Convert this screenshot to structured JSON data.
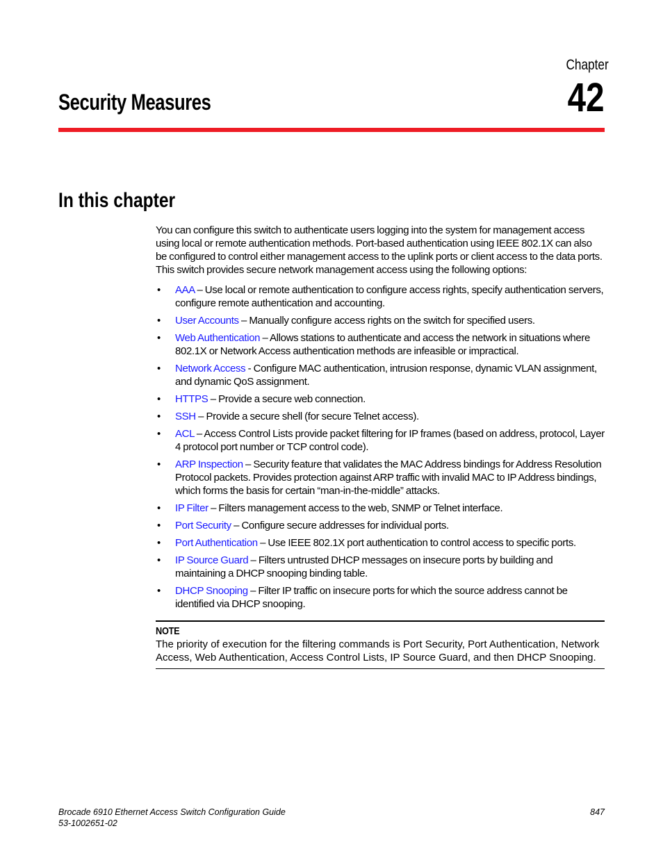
{
  "header": {
    "chapter_label": "Chapter",
    "chapter_number": "42",
    "title": "Security Measures",
    "rule_color": "#ee1c25"
  },
  "section": {
    "title": "In this chapter",
    "intro": "You can configure this switch to authenticate users logging into the system for management access using local or remote authentication methods. Port-based authentication using IEEE 802.1X can also be configured to control either management access to the uplink ports or client access to the data ports. This switch provides secure network management access using the following options:",
    "link_color": "#1a1aff",
    "items": [
      {
        "link": "AAA",
        "sep": " – ",
        "text": "Use local or remote authentication to configure access rights, specify authentication servers, configure remote authentication and accounting."
      },
      {
        "link": "User Accounts",
        "sep": " – ",
        "text": "Manually configure access rights on the switch for specified users."
      },
      {
        "link": "Web Authentication",
        "sep": " – ",
        "text": "Allows stations to authenticate and access the network in situations where 802.1X or Network Access authentication methods are infeasible or impractical."
      },
      {
        "link": "Network Access",
        "sep": " - ",
        "text": "Configure MAC authentication, intrusion response, dynamic VLAN assignment, and dynamic QoS assignment."
      },
      {
        "link": "HTTPS",
        "sep": " – ",
        "text": "Provide a secure web connection."
      },
      {
        "link": "SSH",
        "sep": " – ",
        "text": "Provide a secure shell (for secure Telnet access)."
      },
      {
        "link": "ACL",
        "sep": " – ",
        "text": "Access Control Lists provide packet filtering for IP frames (based on address, protocol, Layer 4 protocol port number or TCP control code)."
      },
      {
        "link": "ARP Inspection",
        "sep": " – ",
        "text": "Security feature that validates the MAC Address bindings for Address Resolution Protocol packets. Provides protection against ARP traffic with invalid MAC to IP Address bindings, which forms the basis for certain “man-in-the-middle” attacks."
      },
      {
        "link": "IP Filter",
        "sep": " – ",
        "text": "Filters management access to the web, SNMP or Telnet interface."
      },
      {
        "link": "Port Security",
        "sep": " – ",
        "text": "Configure secure addresses for individual ports."
      },
      {
        "link": "Port Authentication",
        "sep": " – ",
        "text": "Use IEEE 802.1X port authentication to control access to specific ports."
      },
      {
        "link": "IP Source Guard",
        "sep": " – ",
        "text": "Filters untrusted DHCP messages on insecure ports by building and maintaining a DHCP snooping binding table."
      },
      {
        "link": "DHCP Snooping",
        "sep": " – ",
        "text": "Filter IP traffic on insecure ports for which the source address cannot be identified via DHCP snooping."
      }
    ],
    "note": {
      "label": "NOTE",
      "text": "The priority of execution for the filtering commands is Port Security, Port Authentication, Network Access, Web Authentication, Access Control Lists, IP Source Guard, and then DHCP Snooping."
    }
  },
  "footer": {
    "guide_title": "Brocade 6910 Ethernet Access Switch Configuration Guide",
    "doc_number": "53-1002651-02",
    "page_number": "847"
  }
}
